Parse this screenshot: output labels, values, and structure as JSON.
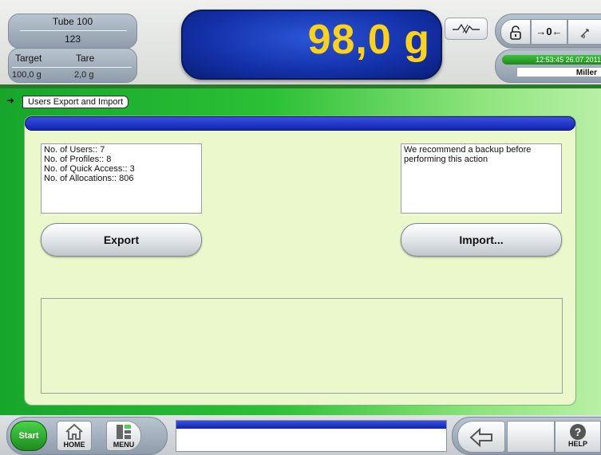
{
  "header": {
    "tube_title": "Tube 100",
    "tube_number": "123",
    "target_label": "Target",
    "tare_label": "Tare",
    "target_value": "100,0 g",
    "tare_value": "2,0 g",
    "weight": "98,0 g",
    "zero_label": "→0←",
    "datetime": "12:53:45  26.07.2011",
    "user": "Miller"
  },
  "breadcrumb": "Users Export and Import",
  "stats": [
    "No. of Users:: 7",
    "No. of Profiles:: 8",
    "No. of Quick Access:: 3",
    "No. of Allocations:: 806"
  ],
  "advice": "We recommend a backup before performing this action",
  "buttons": {
    "export": "Export",
    "import": "Import..."
  },
  "footer": {
    "start": "Start",
    "home": "HOME",
    "menu": "MENU",
    "help": "HELP"
  },
  "icons": [
    "stability-icon",
    "lock-icon",
    "tare-icon",
    "home-icon",
    "menu-icon",
    "back-arrow-icon",
    "help-icon"
  ],
  "colors": {
    "weight_text": "#ffd21a",
    "display_bg": "#1330a8",
    "panel_bg": "#eaf8cc",
    "accent_green": "#1e8a1e"
  }
}
